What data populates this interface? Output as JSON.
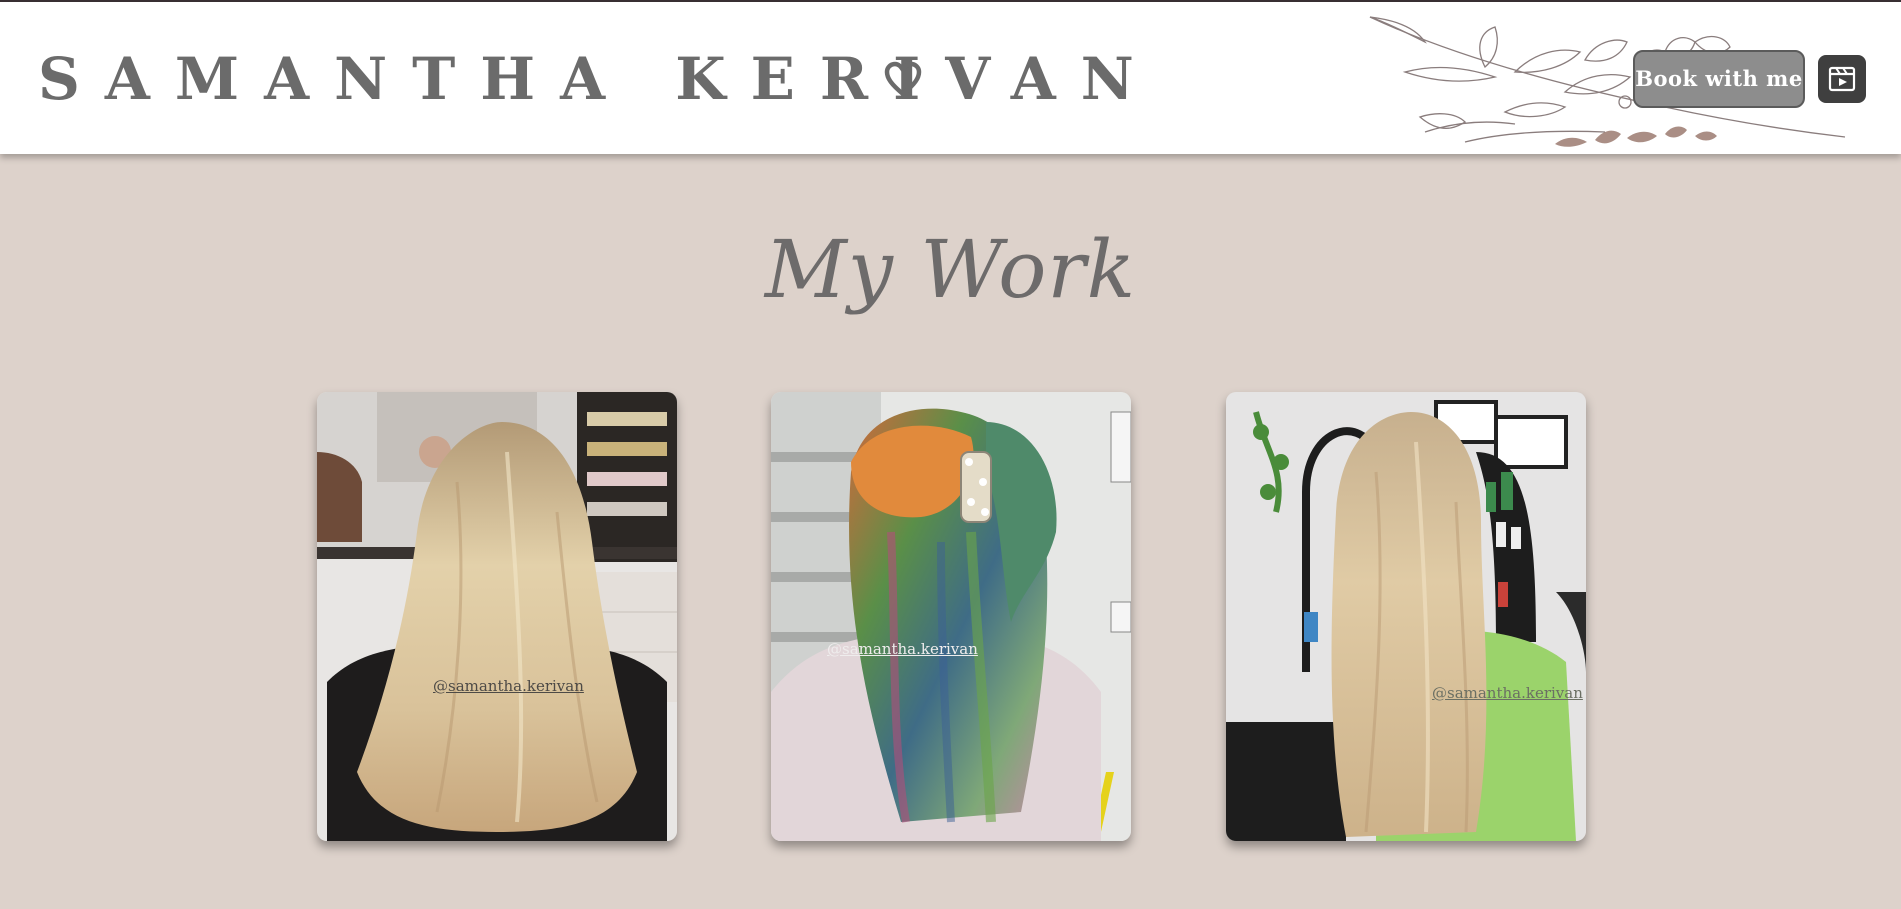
{
  "header": {
    "brand": "SAMANTHA KERIVAN",
    "book_label": "Book with me"
  },
  "icons": {
    "heart": "heart-icon",
    "media": "video-icon",
    "floral": "floral-branch-icon"
  },
  "main": {
    "title": "My Work",
    "gallery": [
      {
        "watermark": "@samantha.kerivan"
      },
      {
        "watermark": "@samantha.kerivan"
      },
      {
        "watermark": "@samantha.kerivan"
      }
    ]
  },
  "colors": {
    "background": "#ddd2cb",
    "header": "#ffffff",
    "brand_text": "#6b6b6b",
    "button": "#8d8d8d",
    "icon_button": "#3f3f3f"
  }
}
